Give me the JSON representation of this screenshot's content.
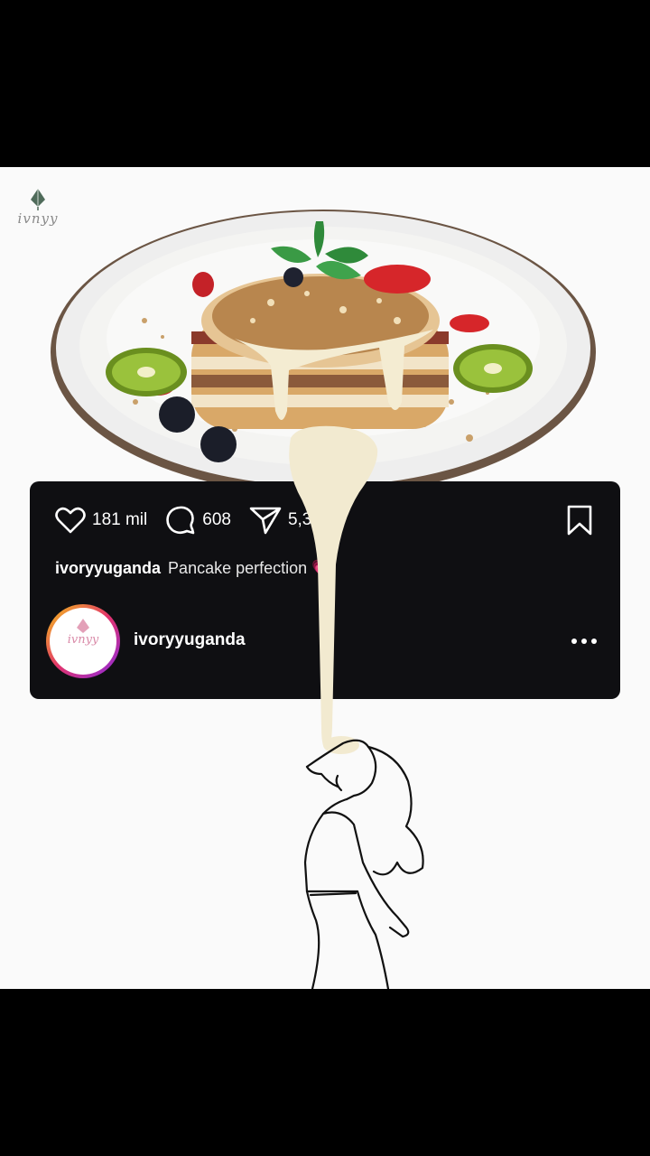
{
  "brand": {
    "logo_text": "ivnyy"
  },
  "post": {
    "likes": "181 mil",
    "comments": "608",
    "shares": "5,3",
    "caption_user": "ivoryyuganda",
    "caption_text": "Pancake perfection",
    "caption_emoji": "💗"
  },
  "profile": {
    "username": "ivoryyuganda",
    "avatar_text": "ivnyy"
  },
  "colors": {
    "card_bg": "#0f0f12",
    "page_bg": "#fafafa",
    "frame_bg": "#000000"
  }
}
